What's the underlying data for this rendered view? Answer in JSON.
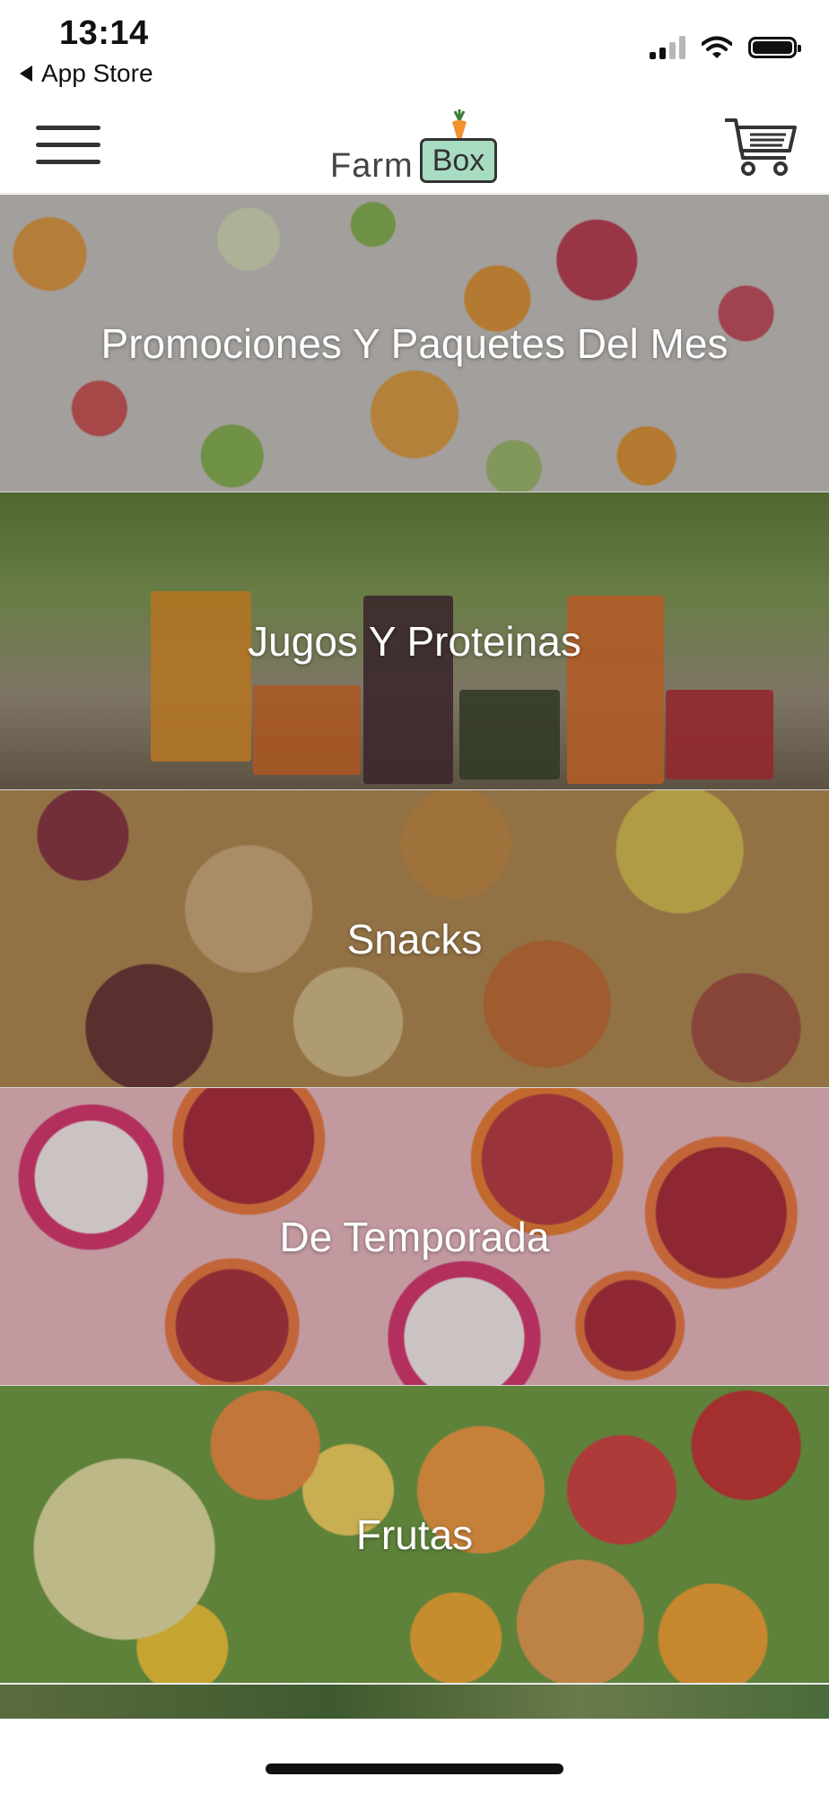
{
  "status_bar": {
    "time": "13:14",
    "back_app": "App Store"
  },
  "header": {
    "logo_text_1": "Farm",
    "logo_text_2": "Box"
  },
  "categories": [
    {
      "label": "Promociones Y Paquetes Del Mes"
    },
    {
      "label": "Jugos Y Proteinas"
    },
    {
      "label": "Snacks"
    },
    {
      "label": "De Temporada"
    },
    {
      "label": "Frutas"
    }
  ],
  "icons": [
    "signal-icon",
    "wifi-icon",
    "battery-icon",
    "menu-icon",
    "cart-icon",
    "carrot-icon"
  ],
  "colors": {
    "logo_box": "#a8dcc2",
    "text_dark": "#333333",
    "overlay_text": "#ffffff"
  }
}
